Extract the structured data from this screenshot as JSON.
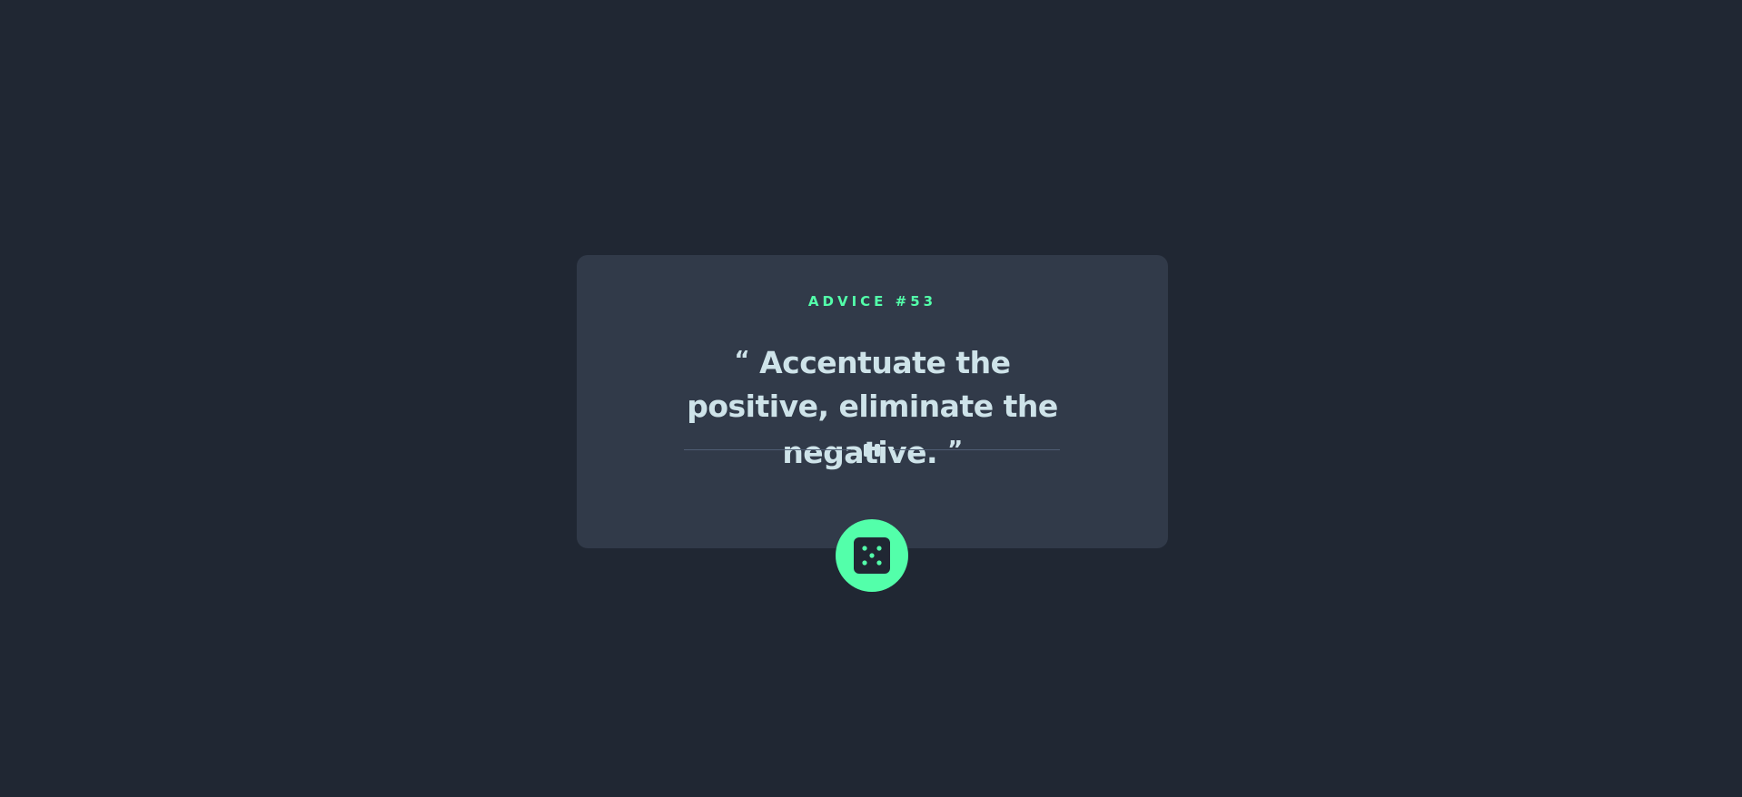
{
  "card": {
    "advice_label": "ADVICE #53",
    "quote_open": "“",
    "quote_text": "Accentuate the positive, eliminate the negative.",
    "quote_close": "”"
  },
  "icons": {
    "divider": "pause-icon",
    "button": "dice-icon"
  },
  "colors": {
    "background": "#202733",
    "card": "#313a49",
    "accent": "#53ffaa",
    "text": "#cee3e9",
    "divider": "#4f5d74"
  }
}
